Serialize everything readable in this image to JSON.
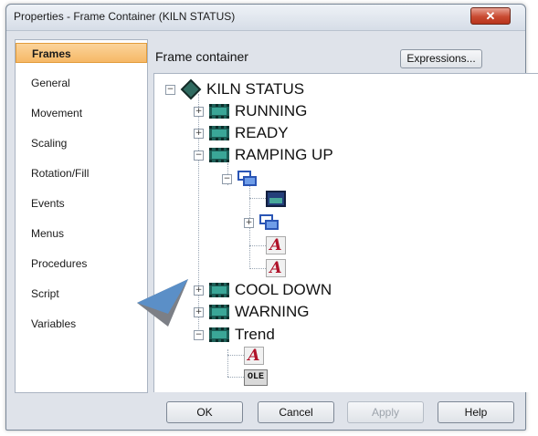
{
  "window": {
    "title": "Properties - Frame Container (KILN STATUS)",
    "close_glyph": "✕"
  },
  "nav": {
    "items": [
      {
        "label": "Frames",
        "selected": true
      },
      {
        "label": "General",
        "selected": false
      },
      {
        "label": "Movement",
        "selected": false
      },
      {
        "label": "Scaling",
        "selected": false
      },
      {
        "label": "Rotation/Fill",
        "selected": false
      },
      {
        "label": "Events",
        "selected": false
      },
      {
        "label": "Menus",
        "selected": false
      },
      {
        "label": "Procedures",
        "selected": false
      },
      {
        "label": "Script",
        "selected": false
      },
      {
        "label": "Variables",
        "selected": false
      }
    ]
  },
  "content": {
    "header_label": "Frame container",
    "expressions_button": "Expressions..."
  },
  "tree": {
    "root": "KILN STATUS",
    "running": "RUNNING",
    "ready": "READY",
    "ramping_up": "RAMPING UP",
    "cool_down": "COOL DOWN",
    "warning": "WARNING",
    "trend": "Trend",
    "expand_glyph": "+",
    "collapse_glyph": "−",
    "text_glyph": "A",
    "ole_text": "OLE"
  },
  "buttons": {
    "ok": "OK",
    "cancel": "Cancel",
    "apply": "Apply",
    "help": "Help"
  },
  "colors": {
    "selected_tab_bg": "#f6b866",
    "pointer_arrow": "#5b8fc7"
  }
}
